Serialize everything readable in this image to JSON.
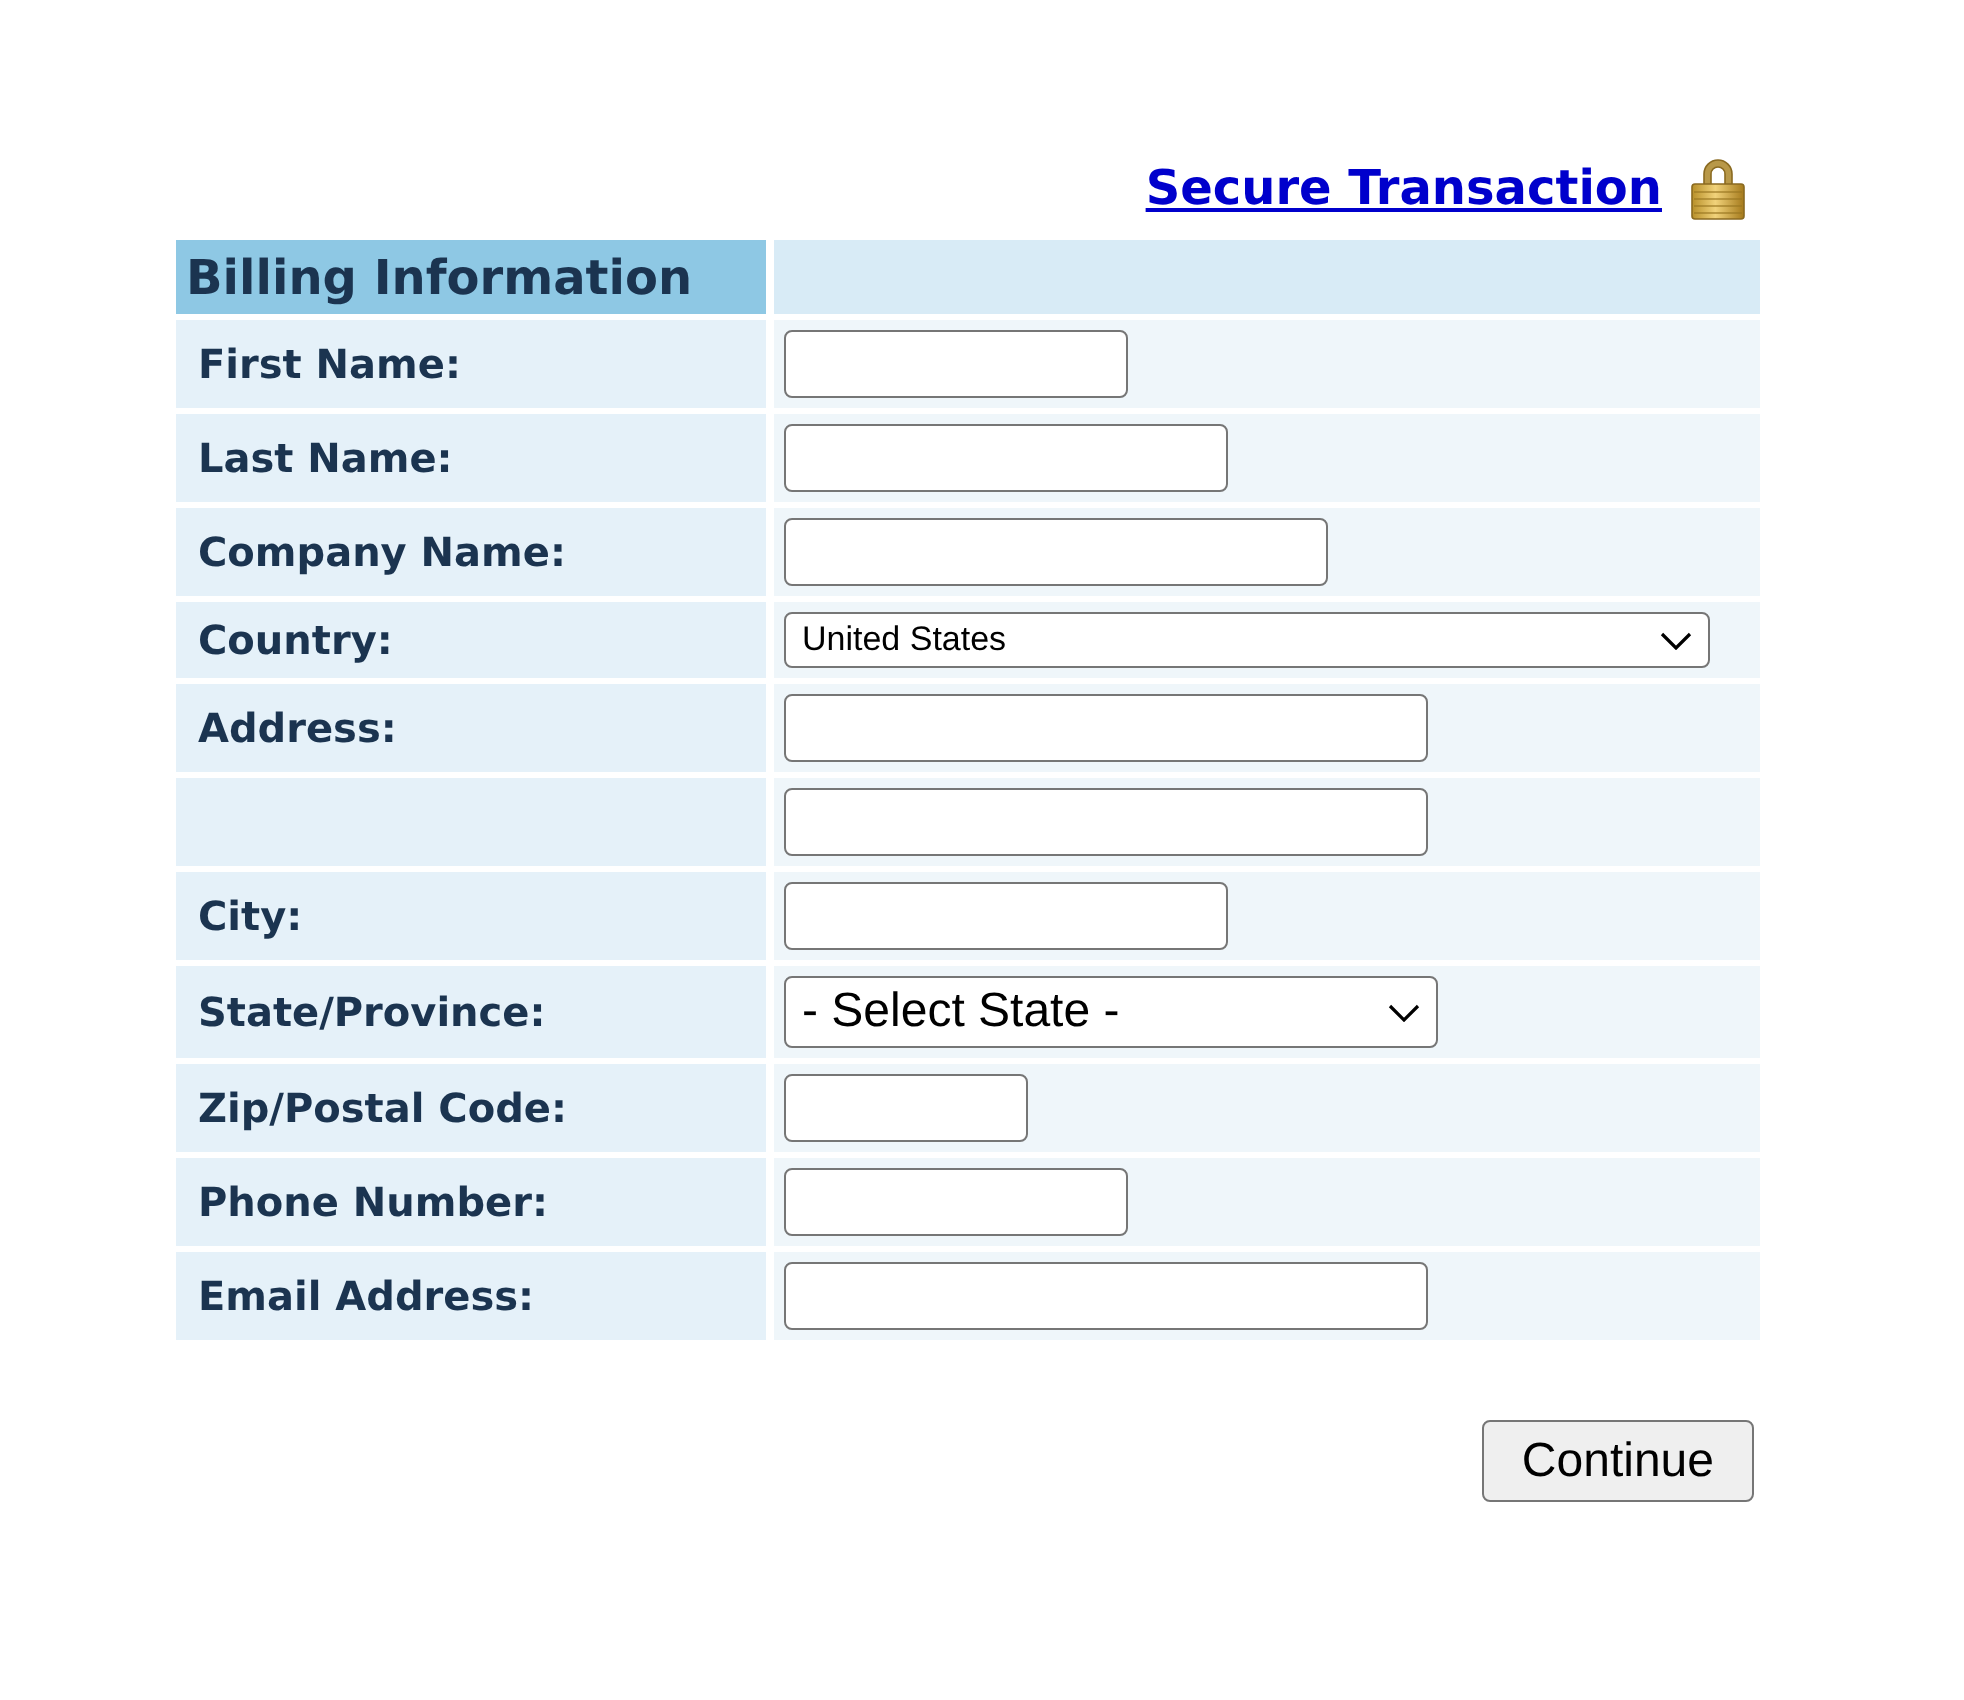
{
  "header": {
    "link": "Secure Transaction"
  },
  "billing": {
    "title": "Billing Information",
    "fields": [
      {
        "label": "First Name:",
        "kind": "text"
      },
      {
        "label": "Last Name:",
        "kind": "text"
      },
      {
        "label": "Company Name:",
        "kind": "text"
      },
      {
        "label": "Country:",
        "kind": "select",
        "value": "United States"
      },
      {
        "label": "Address:",
        "kind": "text"
      },
      {
        "kind": "text"
      },
      {
        "label": "City:",
        "kind": "text"
      },
      {
        "label": "State/Province:",
        "kind": "select",
        "value": "- Select State -"
      },
      {
        "label": "Zip/Postal Code:",
        "kind": "text"
      },
      {
        "label": "Phone Number:",
        "kind": "text"
      },
      {
        "label": "Email Address:",
        "kind": "text"
      }
    ]
  },
  "continue_button": {
    "label": "Continue"
  }
}
